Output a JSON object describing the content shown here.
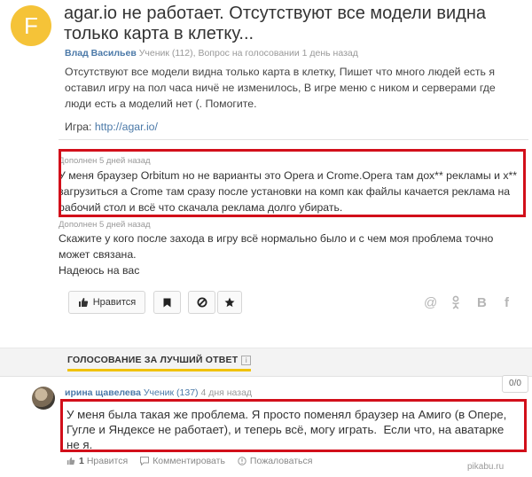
{
  "question": {
    "avatar_letter": "F",
    "title": "agar.io не работает. Отсутствуют все модели видна только карта в клетку...",
    "author": "Влад Васильев",
    "meta_rest": "Ученик (112), Вопрос на голосовании 1 день назад",
    "body": "Отсутствуют все модели видна только карта в клетку, Пишет что много людей есть я оставил игру на пол часа ничё не изменилось, В игре меню с ником и серверами где люди есть а моделий нет (. Помогите.",
    "link_label": "Игра:",
    "link_url": "http://agar.io/"
  },
  "additions": [
    {
      "label": "Дополнен 5 дней назад",
      "text": "У меня браузер Orbitum но не варианты это Opera и Crome.Opera там дох** рекламы и х** загрузиться а Crome там сразу после установки на комп как файлы качается реклама на рабочий стол и всё что скачала реклама долго убирать."
    },
    {
      "label": "Дополнен 5 дней назад",
      "text_lines": [
        "Скажите у кого после захода в игру всё нормально было и с чем моя проблема точно может связана.",
        "Надеюсь на вас"
      ]
    }
  ],
  "toolbar": {
    "like_label": "Нравится",
    "bookmark_icon": "bookmark-icon",
    "block_icon": "block-icon",
    "star_icon": "star-icon"
  },
  "share": {
    "mail": "@",
    "ok": "ok-icon",
    "vk": "B",
    "fb": "f"
  },
  "vote_section": {
    "heading": "ГОЛОСОВАНИЕ ЗА ЛУЧШИЙ ОТВЕТ",
    "info": "i"
  },
  "answer": {
    "author": "ирина щавелева",
    "level": "Ученик",
    "level_count": "(137)",
    "time": "4 дня назад",
    "score": "0/0",
    "text": "У меня была такая же проблема. Я просто поменял браузер на Амиго (в Опере, Гугле и Яндексе не работает), и теперь всё, могу играть.  Если что, на аватарке не я.",
    "like_count": "1",
    "like_label": "Нравится",
    "comment_label": "Комментировать",
    "report_label": "Пожаловаться"
  },
  "watermark": "pikabu.ru",
  "colors": {
    "highlight_border": "#d20f1a",
    "link": "#4b79a8",
    "avatar_bg": "#f5c338",
    "vote_underline": "#f0c20a"
  }
}
